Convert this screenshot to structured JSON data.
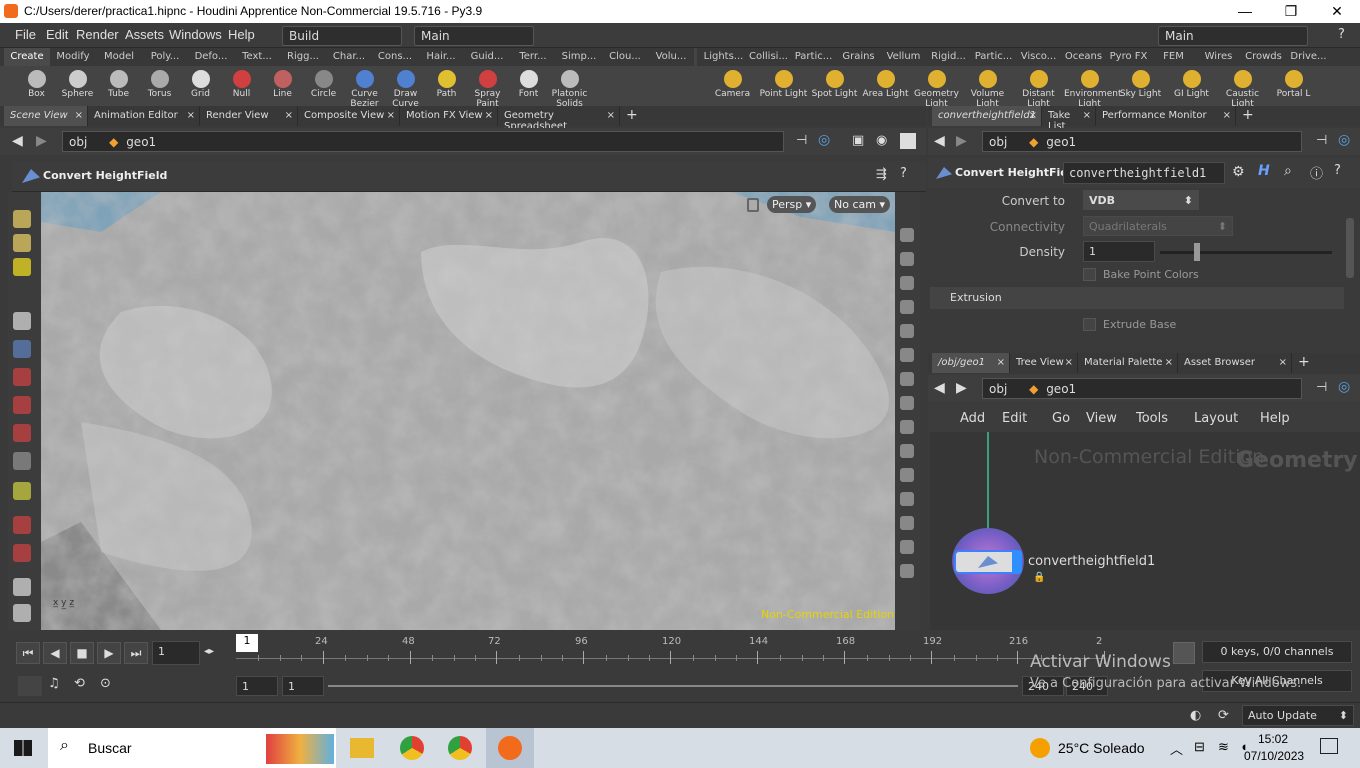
{
  "window": {
    "title": "C:/Users/derer/practica1.hipnc - Houdini Apprentice Non-Commercial 19.5.716 - Py3.9",
    "minimize": "—",
    "maximize": "❐",
    "close": "✕"
  },
  "menu": {
    "items": [
      "File",
      "Edit",
      "Render",
      "Assets",
      "Windows",
      "Help"
    ],
    "build": "Build",
    "main": "Main",
    "desktop": "Main"
  },
  "shelf_left": {
    "tabs": [
      "Create",
      "Modify",
      "Model",
      "Poly...",
      "Defo...",
      "Text...",
      "Rigg...",
      "Char...",
      "Cons...",
      "Hair...",
      "Guid...",
      "Terr...",
      "Simp...",
      "Clou...",
      "Volu..."
    ],
    "tools": [
      "Box",
      "Sphere",
      "Tube",
      "Torus",
      "Grid",
      "Null",
      "Line",
      "Circle",
      "Curve Bezier",
      "Draw Curve",
      "Path",
      "Spray Paint",
      "Font",
      "Platonic Solids"
    ]
  },
  "shelf_right": {
    "tabs": [
      "Lights...",
      "Collisi...",
      "Partic...",
      "Grains",
      "Vellum",
      "Rigid...",
      "Partic...",
      "Visco...",
      "Oceans",
      "Pyro FX",
      "FEM",
      "Wires",
      "Crowds",
      "Drive..."
    ],
    "tools": [
      "Camera",
      "Point Light",
      "Spot Light",
      "Area Light",
      "Geometry Light",
      "Volume Light",
      "Distant Light",
      "Environment Light",
      "Sky Light",
      "GI Light",
      "Caustic Light",
      "Portal L"
    ]
  },
  "left_pane": {
    "tabs": [
      "Scene View",
      "Animation Editor",
      "Render View",
      "Composite View",
      "Motion FX View",
      "Geometry Spreadsheet"
    ],
    "path": [
      "obj",
      "geo1"
    ],
    "node_label": "Convert HeightField",
    "persp": "Persp ▾",
    "cam": "No cam ▾",
    "watermark": "Non-Commercial Edition"
  },
  "right_top": {
    "tabs": [
      "convertheightfield1",
      "Take List",
      "Performance Monitor"
    ],
    "path": [
      "obj",
      "geo1"
    ],
    "node_type": "Convert HeightField",
    "node_name": "convertheightfield1",
    "params": {
      "convert_to_label": "Convert to",
      "convert_to_value": "VDB",
      "connectivity_label": "Connectivity",
      "connectivity_value": "Quadrilaterals",
      "density_label": "Density",
      "density_value": "1",
      "bake_label": "Bake Point Colors",
      "extrusion_label": "Extrusion",
      "extrude_base_label": "Extrude Base",
      "density_fraction": 0.2
    }
  },
  "right_bottom": {
    "tabs": [
      "/obj/geo1",
      "Tree View",
      "Material Palette",
      "Asset Browser"
    ],
    "path": [
      "obj",
      "geo1"
    ],
    "menu": [
      "Add",
      "Edit",
      "Go",
      "View",
      "Tools",
      "Layout",
      "Help"
    ],
    "watermark": "Non-Commercial Edition",
    "context": "Geometry",
    "node_name": "convertheightfield1"
  },
  "timeline": {
    "current_frame": "1",
    "ticks": [
      "24",
      "48",
      "72",
      "96",
      "120",
      "144",
      "168",
      "192",
      "216",
      "2"
    ],
    "start": "1",
    "start2": "1",
    "end": "240",
    "end2": "240",
    "keys": "0 keys, 0/0 channels",
    "key_all": "Key All Channels",
    "auto_update": "Auto Update",
    "activate": "Activar Windows",
    "activate_sub": "Ve a Configuración para activar Windows."
  },
  "taskbar": {
    "search": "Buscar",
    "weather": "25°C  Soleado",
    "time": "15:02",
    "date": "07/10/2023"
  },
  "colors": {
    "accent": "#f26a1b",
    "node_blue": "#3a7bd5",
    "watermark_yellow": "#e6d400"
  }
}
